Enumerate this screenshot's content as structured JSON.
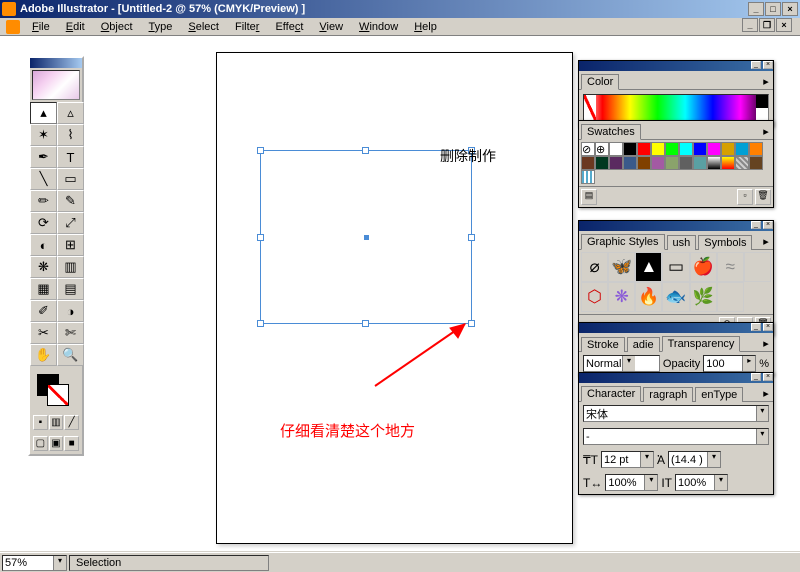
{
  "titlebar": {
    "app": "Adobe Illustrator",
    "doc": "[Untitled-2 @ 57% (CMYK/Preview) ]"
  },
  "menu": {
    "file": "File",
    "edit": "Edit",
    "object": "Object",
    "type": "Type",
    "select": "Select",
    "filter": "Filter",
    "effect": "Effect",
    "view": "View",
    "window": "Window",
    "help": "Help"
  },
  "annotation": {
    "chinese1": "删除制作",
    "chinese2": "仔细看清楚这个地方"
  },
  "panels": {
    "color_tab": "Color",
    "swatches_tab": "Swatches",
    "styles_tab": "Graphic Styles",
    "styles_tab2": "ush",
    "symbols_tab": "Symbols",
    "stroke_tab": "Stroke",
    "stroke_tab2": "adie",
    "transp_tab": "Transparency",
    "char_tab": "Character",
    "para_tab": "ragraph",
    "ot_tab": "enType",
    "blend": "Normal",
    "opacity_lbl": "Opacity",
    "opacity_val": "100",
    "pct": "%",
    "font_name": "宋体",
    "font_style": "-",
    "font_size": "12 pt",
    "leading": "(14.4 )",
    "hscale": "100%",
    "vscale": "100%"
  },
  "status": {
    "zoom": "57%",
    "label": "Selection"
  }
}
